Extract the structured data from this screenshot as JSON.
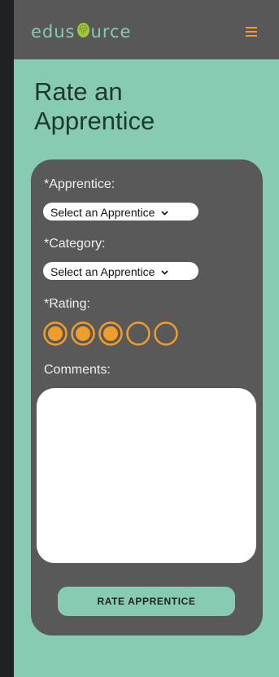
{
  "header": {
    "logo_left": "edus",
    "logo_right": "urce",
    "logo_icon": "fingerprint-icon",
    "menu_icon": "hamburger-menu-icon"
  },
  "page": {
    "title": "Rate an Apprentice"
  },
  "form": {
    "apprentice_label": "*Apprentice:",
    "apprentice_select_value": "Select an Apprentice",
    "category_label": "*Category:",
    "category_select_value": "Select an Apprentice",
    "rating_label": "*Rating:",
    "rating_value": 3,
    "rating_max": 5,
    "comments_label": "Comments:",
    "comments_value": "",
    "submit_label": "RATE APPRENTICE"
  },
  "colors": {
    "brand_green": "#86cbb2",
    "accent_orange": "#f29c2b",
    "header_gray": "#585858",
    "card_gray": "#595959",
    "page_outer": "#1f2125",
    "title_text": "#1e3a2c"
  }
}
